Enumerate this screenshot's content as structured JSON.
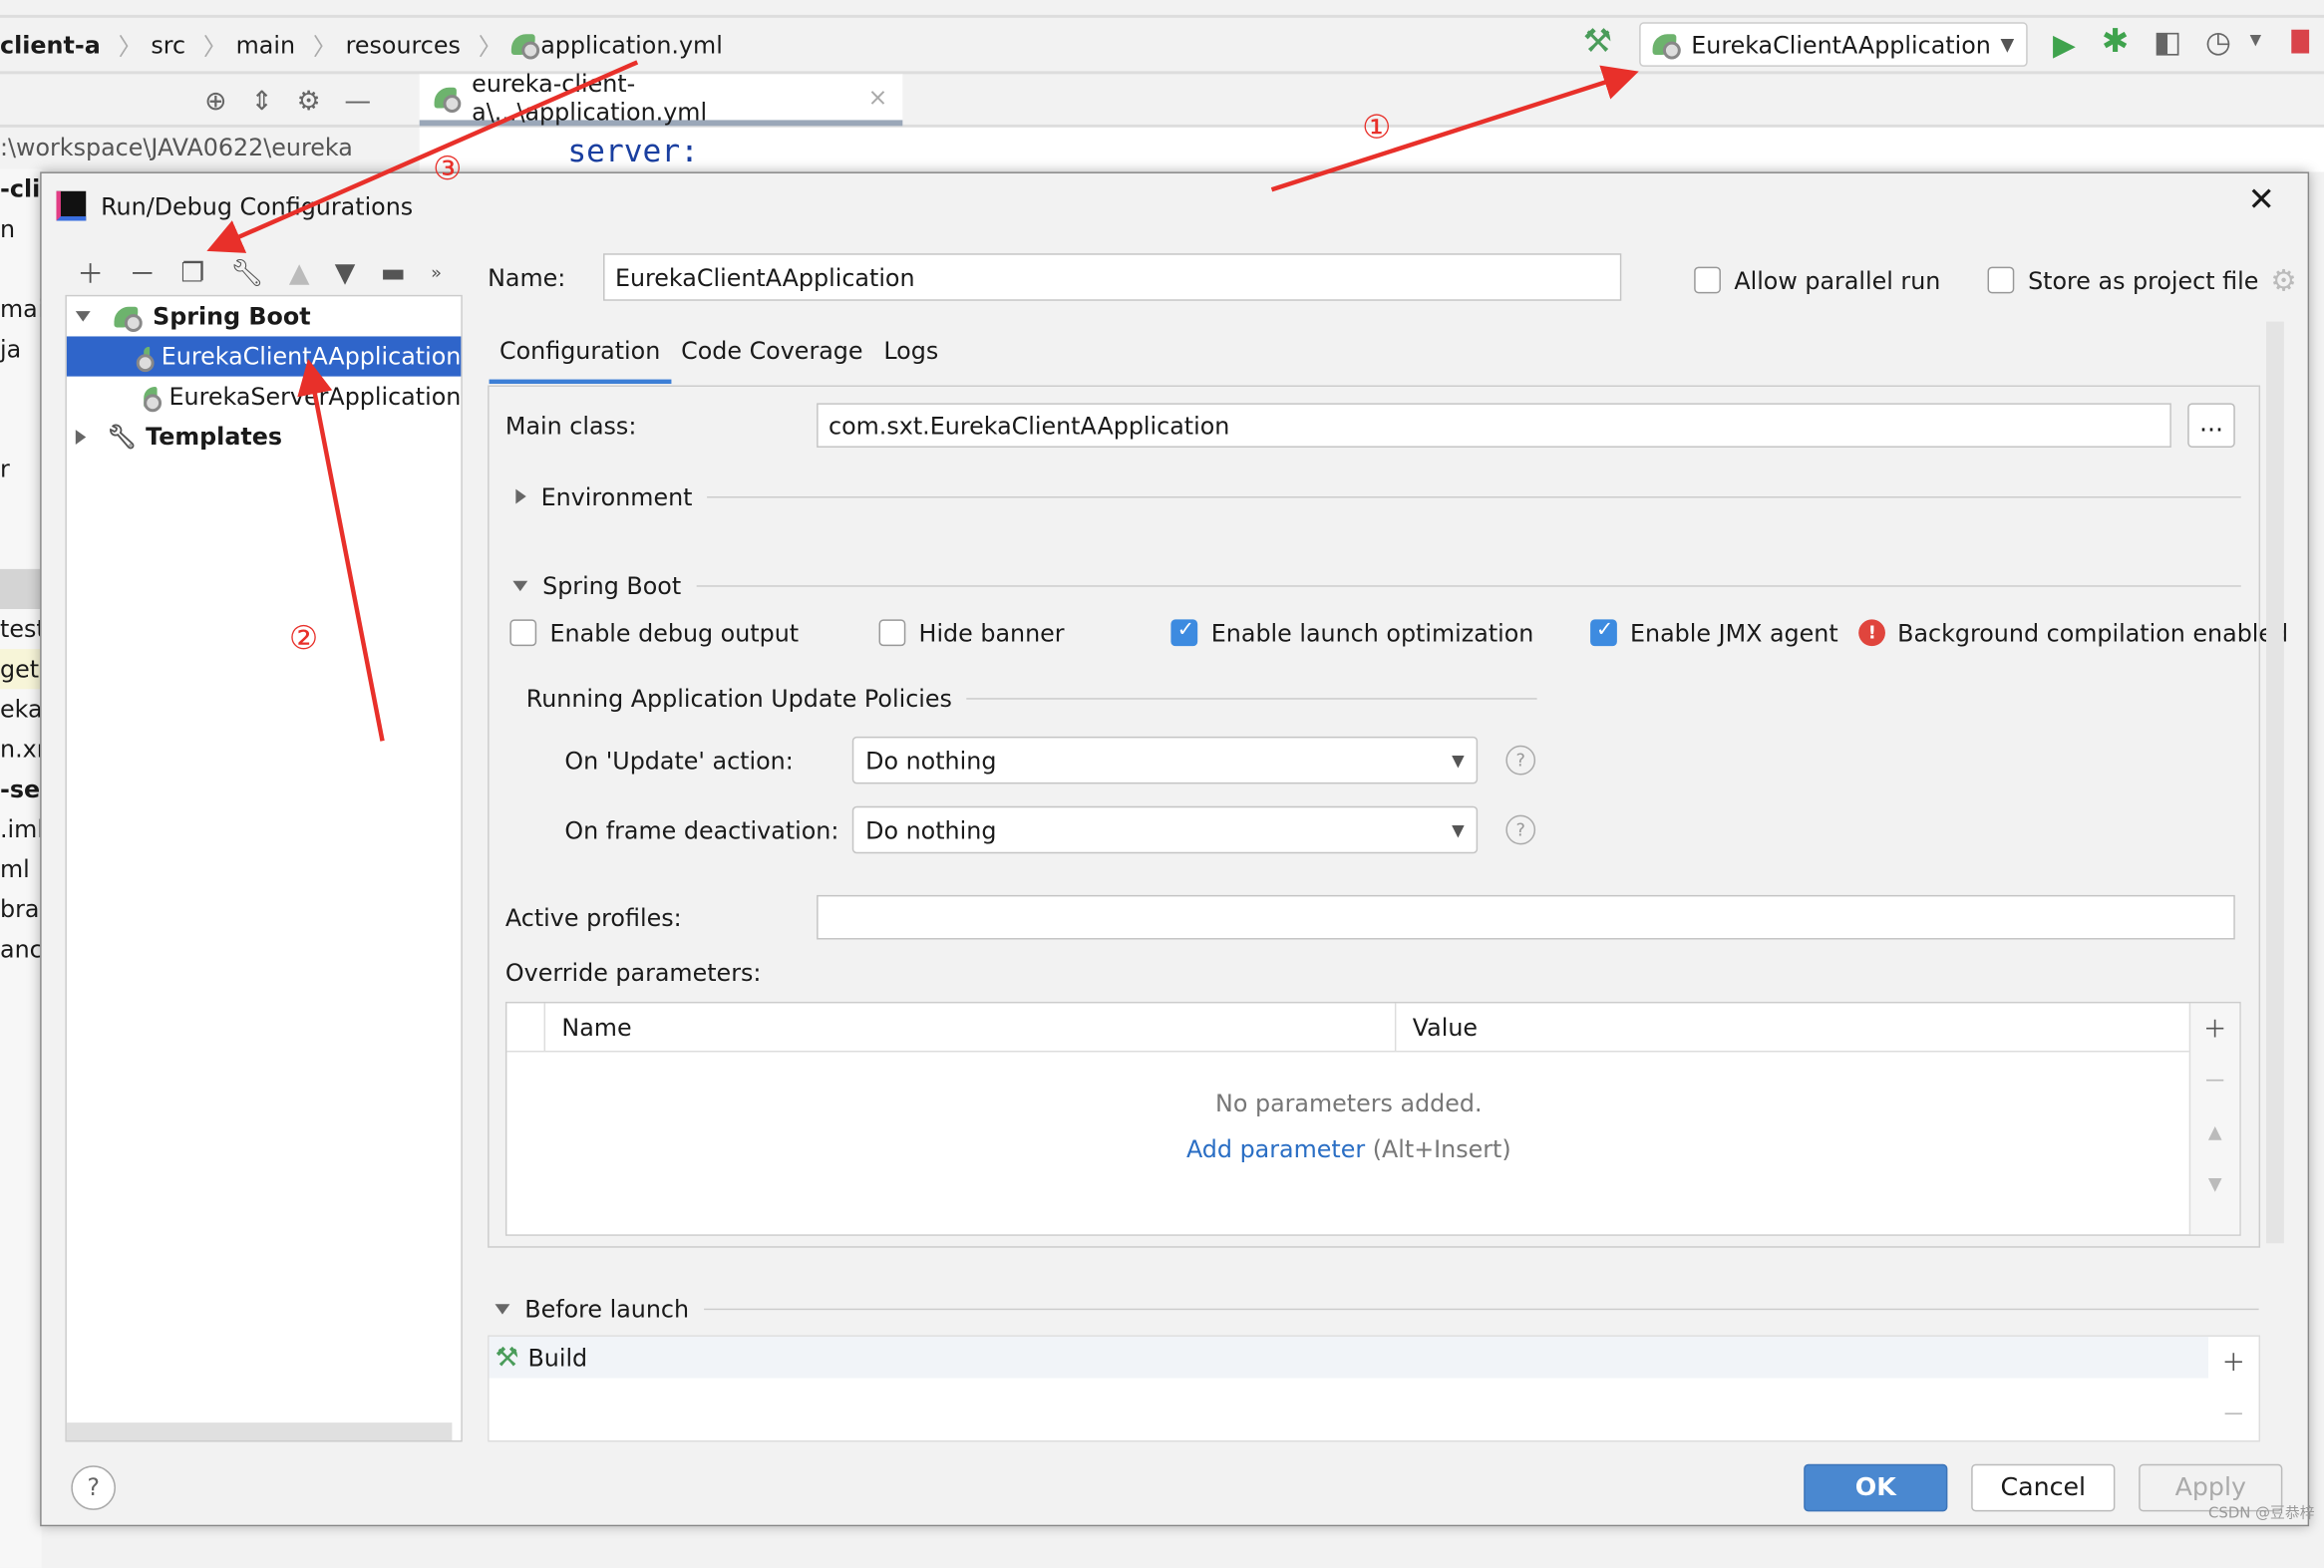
{
  "toolbar": {
    "breadcrumb": [
      "client-a",
      "src",
      "main",
      "resources",
      "application.yml"
    ],
    "run_config": "EurekaClientAApplication",
    "icons": [
      "build-hammer-icon",
      "run-icon",
      "debug-icon",
      "coverage-icon",
      "profile-icon",
      "stop-icon"
    ]
  },
  "editor": {
    "tab_label": "eureka-client-a\\...\\application.yml",
    "code_line": "server:",
    "project_path": ":\\workspace\\JAVA0622\\eureka"
  },
  "sidebar_fragments": [
    "-cli",
    "n",
    "",
    "main",
    "ja",
    "",
    "",
    "r",
    "",
    "",
    "",
    "test",
    "get",
    "eka-",
    "n.xn",
    "-se",
    ".iml",
    "ml",
    "bra",
    "anc"
  ],
  "dialog": {
    "title": "Run/Debug Configurations",
    "tree": {
      "group": "Spring Boot",
      "items": [
        "EurekaClientAApplication",
        "EurekaServerApplication"
      ],
      "templates": "Templates"
    },
    "name_label": "Name:",
    "name_value": "EurekaClientAApplication",
    "allow_parallel": {
      "label": "Allow parallel run",
      "checked": false
    },
    "store_project": {
      "label": "Store as project file",
      "checked": false
    },
    "tabs": [
      "Configuration",
      "Code Coverage",
      "Logs"
    ],
    "active_tab": "Configuration",
    "main_class_label": "Main class:",
    "main_class_value": "com.sxt.EurekaClientAApplication",
    "browse": "...",
    "environment": "Environment",
    "spring_boot": "Spring Boot",
    "options": [
      {
        "label": "Enable debug output",
        "checked": false
      },
      {
        "label": "Hide banner",
        "checked": false
      },
      {
        "label": "Enable launch optimization",
        "checked": true
      },
      {
        "label": "Enable JMX agent",
        "checked": true
      }
    ],
    "bg_compilation": "Background compilation enabled",
    "policies_title": "Running Application Update Policies",
    "update_label": "On 'Update' action:",
    "update_value": "Do nothing",
    "frame_label": "On frame deactivation:",
    "frame_value": "Do nothing",
    "profiles_label": "Active profiles:",
    "profiles_value": "",
    "override_label": "Override parameters:",
    "table_headers": [
      "Name",
      "Value"
    ],
    "empty_text": "No parameters added.",
    "add_param": "Add parameter",
    "add_param_hint": "(Alt+Insert)",
    "before_launch": "Before launch",
    "build": "Build",
    "ok": "OK",
    "cancel": "Cancel",
    "apply": "Apply",
    "help": "?"
  },
  "annotations": [
    "①",
    "②",
    "③"
  ],
  "watermark": "CSDN @豆恭梓",
  "colors": {
    "accent": "#2f65ca",
    "ok_button": "#4a88d0",
    "annotation": "#e8302a",
    "spring_green": "#6db36d"
  }
}
